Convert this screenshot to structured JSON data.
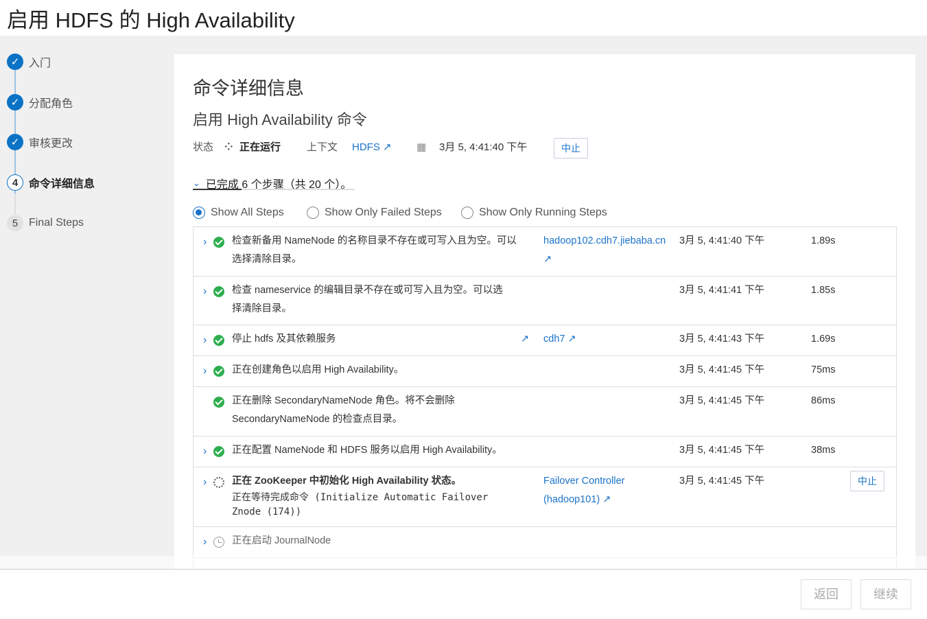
{
  "page": {
    "title": "启用 HDFS 的 High Availability"
  },
  "wizard": {
    "steps": [
      {
        "num": "",
        "label": "入门",
        "state": "done"
      },
      {
        "num": "",
        "label": "分配角色",
        "state": "done"
      },
      {
        "num": "",
        "label": "审核更改",
        "state": "done"
      },
      {
        "num": "4",
        "label": "命令详细信息",
        "state": "current"
      },
      {
        "num": "5",
        "label": "Final Steps",
        "state": "todo"
      }
    ]
  },
  "command": {
    "title": "命令详细信息",
    "subtitle": "启用 High Availability 命令",
    "status_label": "状态",
    "status_value": "正在运行",
    "context_label": "上下文",
    "context_value": "HDFS",
    "timestamp": "3月 5, 4:41:40 下午",
    "abort_label": "中止",
    "progress_text": "已完成 6 个步骤（共 20 个）。",
    "progress_fraction": 0.3
  },
  "filters": {
    "all": "Show All Steps",
    "failed": "Show Only Failed Steps",
    "running": "Show Only Running Steps"
  },
  "steps": [
    {
      "desc": "检查新备用 NameNode 的名称目录不存在或可写入且为空。可以选择清除目录。",
      "context": "hadoop102.cdh7.jiebaba.cn",
      "time": "3月 5, 4:41:40 下午",
      "duration": "1.89s",
      "status": "ok"
    },
    {
      "desc": "检查 nameservice 的编辑目录不存在或可写入且为空。可以选择清除目录。",
      "context": "",
      "time": "3月 5, 4:41:41 下午",
      "duration": "1.85s",
      "status": "ok"
    },
    {
      "desc": "停止 hdfs 及其依赖服务",
      "context": "cdh7",
      "time": "3月 5, 4:41:43 下午",
      "duration": "1.69s",
      "status": "ok"
    },
    {
      "desc": "正在创建角色以启用 High Availability。",
      "context": "",
      "time": "3月 5, 4:41:45 下午",
      "duration": "75ms",
      "status": "ok"
    },
    {
      "desc": "正在删除 SecondaryNameNode 角色。将不会删除 SecondaryNameNode 的检查点目录。",
      "context": "",
      "time": "3月 5, 4:41:45 下午",
      "duration": "86ms",
      "status": "ok"
    },
    {
      "desc": "正在配置 NameNode 和 HDFS 服务以启用 High Availability。",
      "context": "",
      "time": "3月 5, 4:41:45 下午",
      "duration": "38ms",
      "status": "ok"
    },
    {
      "desc": "正在 ZooKeeper 中初始化 High Availability 状态。",
      "sub": "正在等待完成命令 (Initialize Automatic Failover Znode (174))",
      "context": "Failover Controller (hadoop101)",
      "time": "3月 5, 4:41:45 下午",
      "duration": "",
      "status": "running",
      "abort": "中止"
    },
    {
      "desc": "正在启动 JournalNode",
      "context": "",
      "time": "",
      "duration": "",
      "status": "waiting"
    }
  ],
  "footer": {
    "back": "返回",
    "continue": "继续"
  }
}
